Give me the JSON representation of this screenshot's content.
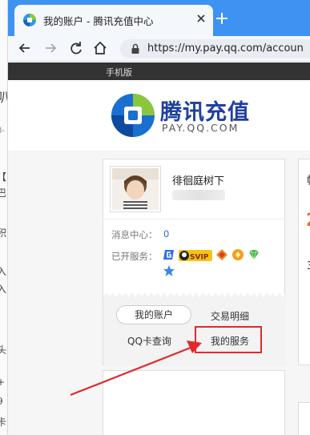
{
  "background_window": {
    "fragments": [
      "叭",
      "8-",
      "【",
      "巴",
      "积",
      "入",
      "入",
      "头",
      "+",
      "9",
      "卡"
    ]
  },
  "browser": {
    "tab": {
      "title": "我的账户 - 腾讯充值中心",
      "favicon": "qq-pay-icon"
    },
    "url": "https://my.pay.qq.com/accoun"
  },
  "page": {
    "topbar": {
      "mobile_link": "手机版"
    },
    "logo": {
      "name_cn": "腾讯充值",
      "name_en": "PAY.QQ.COM"
    },
    "account": {
      "nickname": "徘徊庭树下",
      "message_center_label": "消息中心：",
      "message_count": "0",
      "services_label": "已开服务：",
      "services": [
        "game-g-icon",
        "svip-badge-icon",
        "red-diamond-icon",
        "yellow-diamond-icon",
        "green-diamond-icon",
        "blue-star-icon"
      ],
      "svip_text": "SVIP"
    },
    "links": {
      "my_account": "我的账户",
      "transactions": "交易明细",
      "qq_card_query": "QQ卡查询",
      "my_services": "我的服务"
    },
    "side": {
      "char_a": "帐",
      "char_b": "2",
      "char_c": "3"
    }
  },
  "colors": {
    "tab_strip": "#3d92f2",
    "annotation": "#e02a2a",
    "accent_orange": "#f26a1b"
  }
}
